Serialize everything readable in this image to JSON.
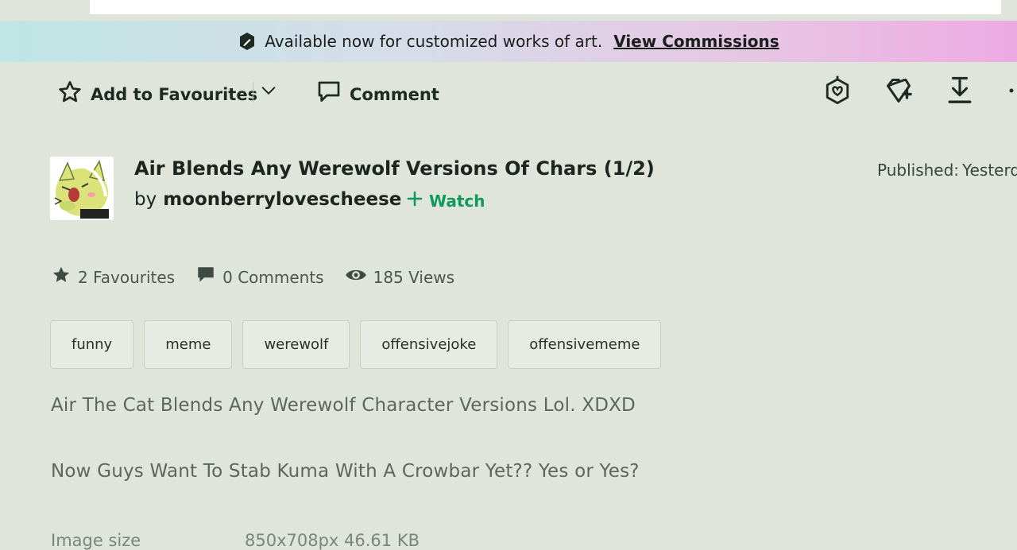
{
  "banner": {
    "text": "Available now for customized works of art.",
    "link": "View Commissions",
    "icon": "commission-badge-icon"
  },
  "actions": {
    "favourite": "Add to Favourites",
    "comment": "Comment",
    "icons": [
      "options-chevron-icon",
      "gift-badge-icon",
      "add-to-collection-icon",
      "download-icon",
      "more-icon"
    ]
  },
  "deviation": {
    "title": "Air Blends Any Werewolf Versions Of Chars (1/2)",
    "by": "by",
    "author": "moonberrylovescheese",
    "watch": "Watch",
    "published_label": "Published:",
    "published_value": "Yesterd"
  },
  "stats": {
    "favourites": "2 Favourites",
    "comments": "0 Comments",
    "views": "185 Views"
  },
  "tags": [
    "funny",
    "meme",
    "werewolf",
    "offensivejoke",
    "offensivememe"
  ],
  "description": [
    "Air The Cat Blends Any Werewolf Character Versions Lol. XDXD",
    "Now Guys Want To Stab Kuma With A Crowbar Yet?? Yes or Yes?"
  ],
  "details": {
    "label": "Image size",
    "value": "850x708px 46.61 KB"
  },
  "colors": {
    "background": "#dfe5db",
    "accent_green": "#0f9a5c",
    "banner_start": "#bfe5e4",
    "banner_end": "#eeaae3"
  }
}
